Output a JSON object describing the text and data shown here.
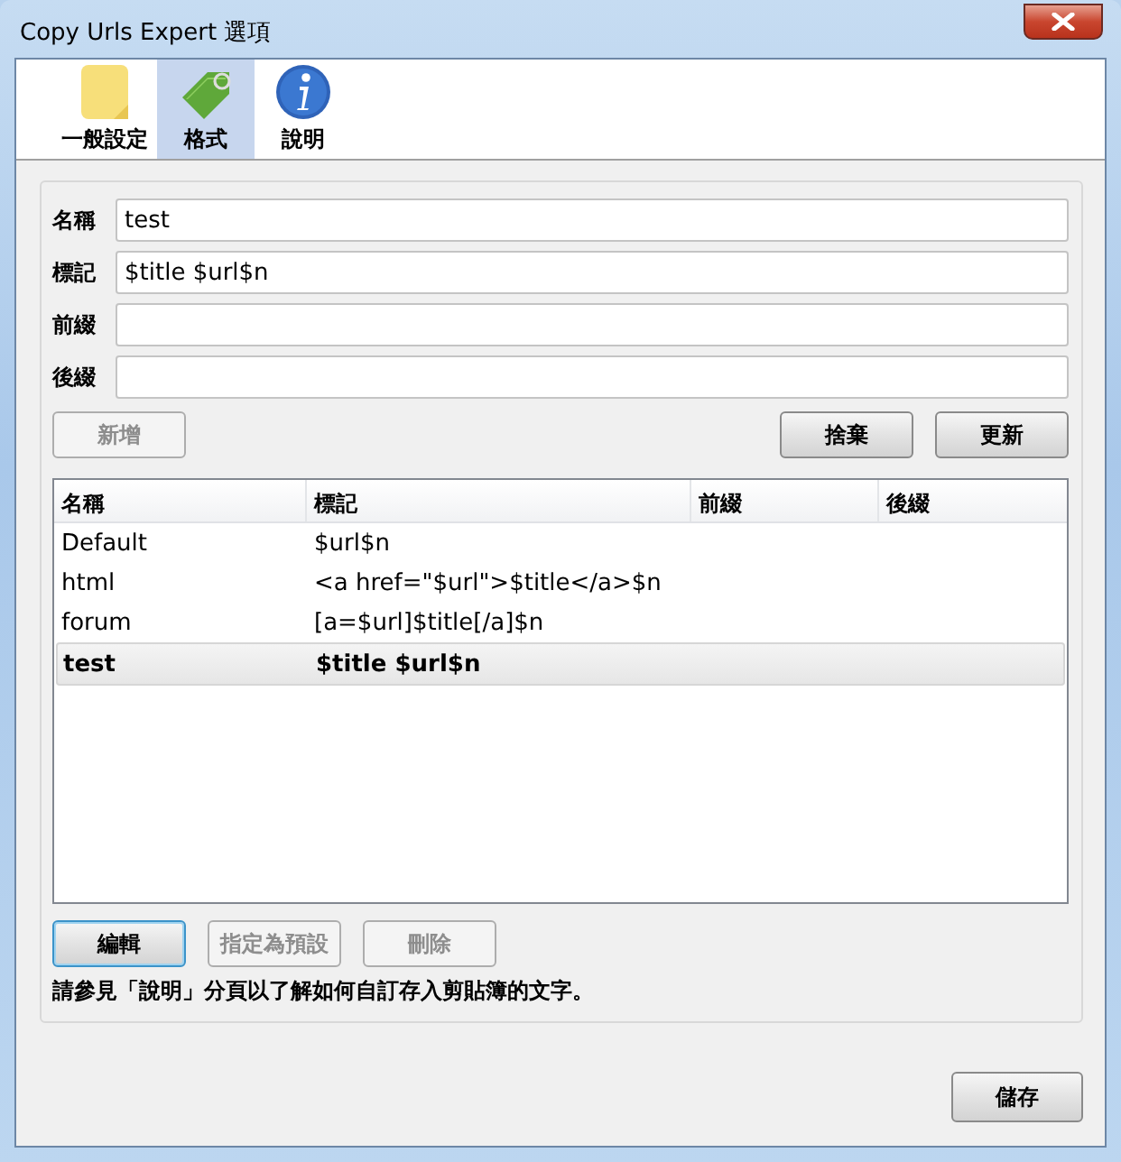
{
  "window": {
    "title": "Copy Urls Expert 選項"
  },
  "tabs": [
    {
      "label": "一般設定",
      "kind": "note",
      "selected": false
    },
    {
      "label": "格式",
      "kind": "tag",
      "selected": true
    },
    {
      "label": "說明",
      "kind": "info",
      "selected": false
    }
  ],
  "fields": [
    {
      "label": "名稱",
      "value": "test"
    },
    {
      "label": "標記",
      "value": "$title $url$n"
    },
    {
      "label": "前綴"
    },
    {
      "label": "後綴"
    }
  ],
  "add_button": {
    "label": "新增",
    "disabled": true
  },
  "form_buttons": [
    {
      "label": "捨棄",
      "disabled": false
    },
    {
      "label": "更新",
      "disabled": false
    }
  ],
  "table": {
    "columns": [
      "名稱",
      "標記",
      "前綴",
      "後綴"
    ],
    "rows": [
      {
        "cells": [
          "Default",
          "$url$n"
        ],
        "selected": false
      },
      {
        "cells": [
          "html",
          "<a href=\"$url\">$title</a>$n"
        ],
        "selected": false
      },
      {
        "cells": [
          "forum",
          "[a=$url]$title[/a]$n"
        ],
        "selected": false
      },
      {
        "cells": [
          "test",
          "$title $url$n"
        ],
        "selected": true
      }
    ]
  },
  "list_buttons": [
    {
      "label": "編輯",
      "disabled": false,
      "focused": true
    },
    {
      "label": "指定為預設",
      "disabled": true,
      "focused": false
    },
    {
      "label": "刪除",
      "disabled": true,
      "focused": false
    }
  ],
  "note": "請參見「說明」分頁以了解如何自訂存入剪貼簿的文字。",
  "save_button": {
    "label": "儲存",
    "disabled": false
  }
}
